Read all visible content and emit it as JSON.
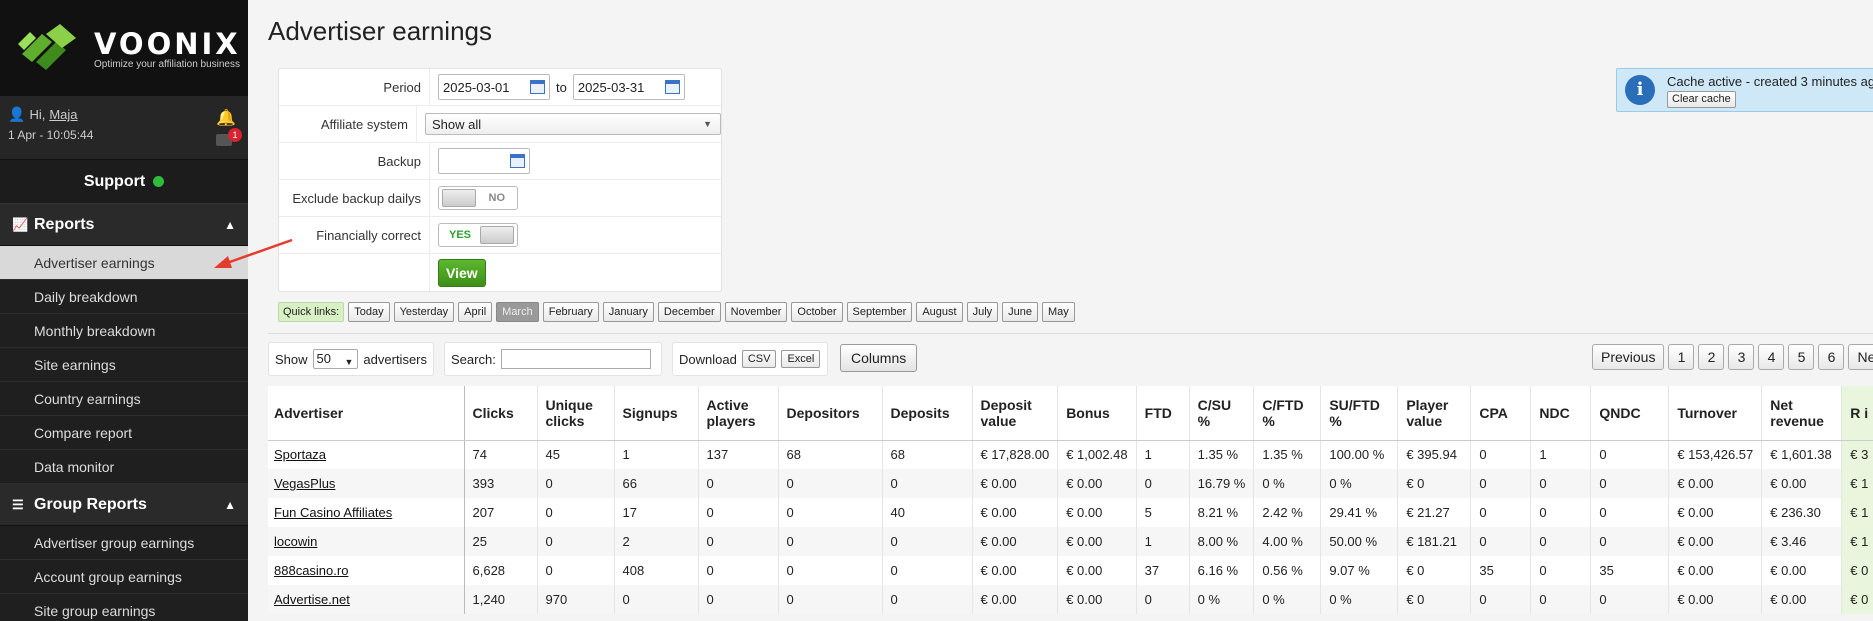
{
  "brand": {
    "name": "VOONIX",
    "tagline": "Optimize your affiliation business"
  },
  "user": {
    "greeting": "Hi,",
    "name": "Maja",
    "timestamp": "1 Apr - 10:05:44",
    "mail_count": "1"
  },
  "support": {
    "label": "Support"
  },
  "sidebar": {
    "reports": {
      "title": "Reports",
      "items": [
        "Advertiser earnings",
        "Daily breakdown",
        "Monthly breakdown",
        "Site earnings",
        "Country earnings",
        "Compare report",
        "Data monitor"
      ]
    },
    "group_reports": {
      "title": "Group Reports",
      "items": [
        "Advertiser group earnings",
        "Account group earnings",
        "Site group earnings"
      ]
    }
  },
  "page": {
    "title": "Advertiser earnings"
  },
  "filters": {
    "period_label": "Period",
    "period_from": "2025-03-01",
    "period_to_word": "to",
    "period_to": "2025-03-31",
    "affiliate_label": "Affiliate system",
    "affiliate_value": "Show all",
    "backup_label": "Backup",
    "exclude_label": "Exclude backup dailys",
    "exclude_value": "NO",
    "financial_label": "Financially correct",
    "financial_value": "YES",
    "view_button": "View"
  },
  "quick_links": {
    "label": "Quick links:",
    "items": [
      "Today",
      "Yesterday",
      "April",
      "March",
      "February",
      "January",
      "December",
      "November",
      "October",
      "September",
      "August",
      "July",
      "June",
      "May"
    ],
    "selected": "March"
  },
  "cache": {
    "text": "Cache active - created 3 minutes ag",
    "clear_button": "Clear cache"
  },
  "table_controls": {
    "show_label": "Show",
    "show_value": "50",
    "show_suffix": "advertisers",
    "search_label": "Search:",
    "download_label": "Download",
    "csv": "CSV",
    "excel": "Excel",
    "columns": "Columns"
  },
  "pagination": {
    "previous": "Previous",
    "pages": [
      "1",
      "2",
      "3",
      "4",
      "5",
      "6"
    ],
    "next": "Ne"
  },
  "table": {
    "headers": [
      "Advertiser",
      "Clicks",
      "Unique clicks",
      "Signups",
      "Active players",
      "Depositors",
      "Deposits",
      "Deposit value",
      "Bonus",
      "FTD",
      "C/SU %",
      "C/FTD %",
      "SU/FTD %",
      "Player value",
      "CPA",
      "NDC",
      "QNDC",
      "Turnover",
      "Net revenue",
      "R i"
    ],
    "rows": [
      [
        "Sportaza",
        "74",
        "45",
        "1",
        "137",
        "68",
        "68",
        "€ 17,828.00",
        "€ 1,002.48",
        "1",
        "1.35 %",
        "1.35 %",
        "100.00 %",
        "€ 395.94",
        "0",
        "1",
        "0",
        "€ 153,426.57",
        "€ 1,601.38",
        "€ 3"
      ],
      [
        "VegasPlus",
        "393",
        "0",
        "66",
        "0",
        "0",
        "0",
        "€ 0.00",
        "€ 0.00",
        "0",
        "16.79 %",
        "0 %",
        "0 %",
        "€ 0",
        "0",
        "0",
        "0",
        "€ 0.00",
        "€ 0.00",
        "€ 1"
      ],
      [
        "Fun Casino Affiliates",
        "207",
        "0",
        "17",
        "0",
        "0",
        "40",
        "€ 0.00",
        "€ 0.00",
        "5",
        "8.21 %",
        "2.42 %",
        "29.41 %",
        "€ 21.27",
        "0",
        "0",
        "0",
        "€ 0.00",
        "€ 236.30",
        "€ 1"
      ],
      [
        "locowin",
        "25",
        "0",
        "2",
        "0",
        "0",
        "0",
        "€ 0.00",
        "€ 0.00",
        "1",
        "8.00 %",
        "4.00 %",
        "50.00 %",
        "€ 181.21",
        "0",
        "0",
        "0",
        "€ 0.00",
        "€ 3.46",
        "€ 1"
      ],
      [
        "888casino.ro",
        "6,628",
        "0",
        "408",
        "0",
        "0",
        "0",
        "€ 0.00",
        "€ 0.00",
        "37",
        "6.16 %",
        "0.56 %",
        "9.07 %",
        "€ 0",
        "35",
        "0",
        "35",
        "€ 0.00",
        "€ 0.00",
        "€ 0"
      ],
      [
        "Advertise.net",
        "1,240",
        "970",
        "0",
        "0",
        "0",
        "0",
        "€ 0.00",
        "€ 0.00",
        "0",
        "0 %",
        "0 %",
        "0 %",
        "€ 0",
        "0",
        "0",
        "0",
        "€ 0.00",
        "€ 0.00",
        "€ 0"
      ]
    ]
  },
  "colors": {
    "sidebar_bg": "#1c1c1c",
    "accent_green": "#3d8f18",
    "status_green": "#2ebd3a",
    "annotation_arrow": "#e53b2c"
  }
}
